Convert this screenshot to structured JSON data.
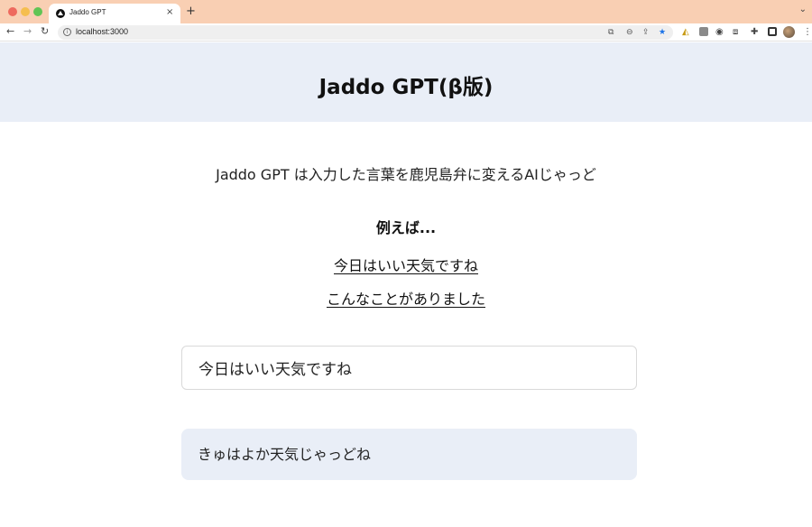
{
  "browser": {
    "tab_title": "Jaddo GPT",
    "tab_close": "×",
    "new_tab": "+",
    "back": "←",
    "forward": "→",
    "reload": "↻",
    "url": "localhost:3000",
    "info_glyph": "i",
    "star_color": "#1a73e8",
    "more_menu": "⋮"
  },
  "header": {
    "title": "Jaddo GPT(β版)",
    "background": "#e9eef7"
  },
  "main": {
    "description": "Jaddo GPT は入力した言葉を鹿児島弁に変えるAIじゃっど",
    "examples_heading": "例えば...",
    "examples": [
      "今日はいい天気ですね",
      "こんなことがありました"
    ],
    "input_value": "今日はいい天気ですね",
    "output_text": "きゅはよか天気じゃっどね"
  }
}
